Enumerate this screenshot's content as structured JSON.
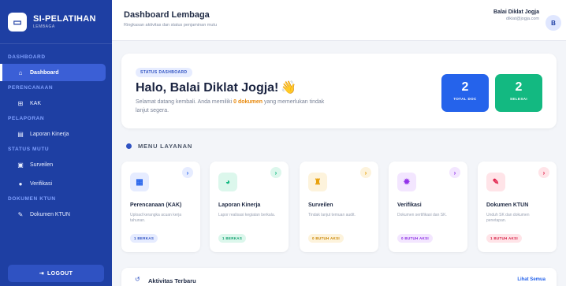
{
  "brand": {
    "title": "SI-PELATIHAN",
    "subtitle": "LEMBAGA",
    "logo_icon": "monitor-icon"
  },
  "sidebar": {
    "sections": [
      {
        "label": "DASHBOARD",
        "items": [
          {
            "label": "Dashboard",
            "icon": "home-icon",
            "active": true
          }
        ]
      },
      {
        "label": "PERENCANAAN",
        "items": [
          {
            "label": "KAK",
            "icon": "sitemap-icon"
          }
        ]
      },
      {
        "label": "PELAPORAN",
        "items": [
          {
            "label": "Laporan Kinerja",
            "icon": "file-icon"
          }
        ]
      },
      {
        "label": "STATUS MUTU",
        "items": [
          {
            "label": "Surveilen",
            "icon": "clipboard-icon"
          },
          {
            "label": "Verifikasi",
            "icon": "check-circle-icon"
          }
        ]
      },
      {
        "label": "DOKUMEN KTUN",
        "items": [
          {
            "label": "Dokumen KTUN",
            "icon": "file-signature-icon"
          }
        ]
      }
    ],
    "logout_label": "LOGOUT"
  },
  "header": {
    "title": "Dashboard Lembaga",
    "subtitle": "Ringkasan aktivitas dan status penjaminan mutu",
    "user_name": "Balai Diklat Jogja",
    "user_email": "diklat@jogja.com",
    "avatar_initial": "B"
  },
  "hero": {
    "badge": "STATUS DASHBOARD",
    "greeting": "Halo, Balai Diklat Jogja!",
    "wave": "👋",
    "text_before": "Selamat datang kembali. Anda memiliki ",
    "highlight": "0 dokumen",
    "text_after": " yang memerlukan tindak lanjut segera.",
    "stats": [
      {
        "value": "2",
        "label": "TOTAL DOC",
        "color": "#2563eb"
      },
      {
        "value": "2",
        "label": "SELESAI",
        "color": "#13b981"
      }
    ]
  },
  "menu": {
    "title": "MENU LAYANAN",
    "cards": [
      {
        "title": "Perencanaan (KAK)",
        "desc": "Upload kerangka acuan kerja tahunan.",
        "pill": "1 BERKAS",
        "icon": "calendar-icon",
        "accent": "#2563eb",
        "bg": "#e6ecff",
        "pill_bg": "#e6ecff",
        "pill_fg": "#2f52c2"
      },
      {
        "title": "Laporan Kinerja",
        "desc": "Lapor realisasi kegiatan berkala.",
        "pill": "1 BERKAS",
        "icon": "pie-chart-icon",
        "accent": "#13b981",
        "bg": "#dcf7ec",
        "pill_bg": "#dcf7ec",
        "pill_fg": "#0f9f6e"
      },
      {
        "title": "Surveilen",
        "desc": "Tindak lanjut temuan audit.",
        "pill": "0 BUTUH AKSI",
        "icon": "hard-hat-icon",
        "accent": "#e8a10c",
        "bg": "#fdf3dc",
        "pill_bg": "#fdf3dc",
        "pill_fg": "#c98400"
      },
      {
        "title": "Verifikasi",
        "desc": "Dokumen sertifikasi dan SK.",
        "pill": "0 BUTUH AKSI",
        "icon": "certificate-icon",
        "accent": "#9333ea",
        "bg": "#f3e6ff",
        "pill_bg": "#f3e6ff",
        "pill_fg": "#8a2be2"
      },
      {
        "title": "Dokumen KTUN",
        "desc": "Unduh SK dan dokumen penetapan.",
        "pill": "1 BUTUH AKSI",
        "icon": "file-signature-icon",
        "accent": "#e11d48",
        "bg": "#ffe4e8",
        "pill_bg": "#ffe4e8",
        "pill_fg": "#d61f45"
      }
    ]
  },
  "activity": {
    "title": "Aktivitas Terbaru",
    "link": "Lihat Semua",
    "icon": "history-icon"
  }
}
